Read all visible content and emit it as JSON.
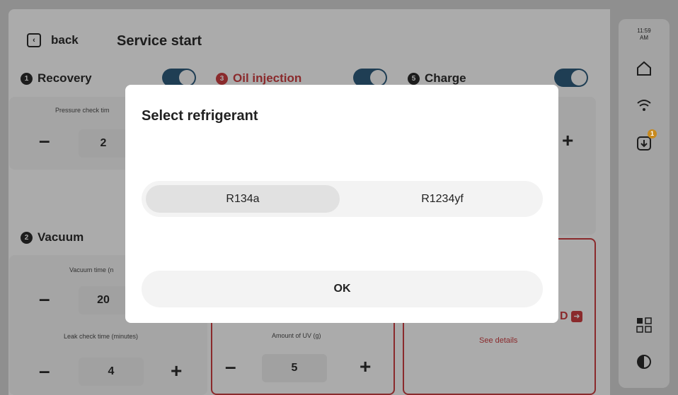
{
  "status": {
    "time": "11:59",
    "ampm": "AM",
    "download_badge": "1"
  },
  "header": {
    "back_label": "back",
    "title": "Service start"
  },
  "steps": {
    "recovery": {
      "num": "1",
      "title": "Recovery",
      "label": "Pressure check tim",
      "value": "2"
    },
    "oil": {
      "num": "3",
      "title": "Oil injection",
      "uv_label": "Amount of UV (g)",
      "uv_value": "5"
    },
    "charge": {
      "num": "5",
      "title": "Charge",
      "fragment": "D",
      "see_details": "See details"
    },
    "vacuum": {
      "num": "2",
      "title": "Vacuum",
      "time_label": "Vacuum time (n",
      "time_value": "20",
      "leak_label": "Leak check time (minutes)",
      "leak_value": "4"
    }
  },
  "modal": {
    "title": "Select refrigerant",
    "options": [
      "R134a",
      "R1234yf"
    ],
    "selected": "R134a",
    "ok_label": "OK"
  },
  "colors": {
    "accent": "#1f3e54",
    "alert": "#8a2a2c",
    "badge": "#c88a1e"
  }
}
